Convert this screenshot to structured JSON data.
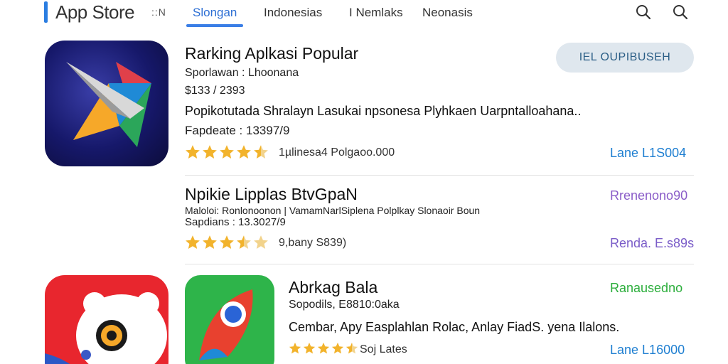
{
  "header": {
    "brand": "App Store",
    "brand_suffix": "::N",
    "tabs": [
      {
        "label": "Slongan",
        "active": true
      },
      {
        "label": "Indonesias",
        "active": false
      },
      {
        "label": "I Nemlaks",
        "active": false
      },
      {
        "label": "Neonasis",
        "active": false
      }
    ],
    "icons": [
      "search-icon",
      "search-icon"
    ],
    "accent": "#3a7ee6"
  },
  "apps": [
    {
      "title": "Rarking Aplkasi Popular",
      "subtitle": "Sporlawan : Lhoonana",
      "price": "$133 / 2393",
      "description": "Popikotutada Shralayn Lasukai npsonesa Plyhkaen Uarpntalloahana..",
      "update": "Fapdeate : 13397/9",
      "rating": 4.5,
      "rating_text": "1µlinesa4 Polgaoo.000",
      "action": "Lane L1S004",
      "action_color": "#1f7fd1",
      "button": "IEL OUPIBUSEH"
    },
    {
      "title": "Npikie Lipplas BtvGpaN",
      "subtitle": "Maloloi: Ronlonoonon | VamamNarlSiplena Polplkay Slonaoir Boun",
      "update": "Sapdians : 13.3027/9",
      "rating": 3.5,
      "rating_text": "9,bany S839)",
      "action_top": "Rrenenono90",
      "action_top_color": "#8a5cc8",
      "action": "Renda. E.s89s",
      "action_color": "#7a5cc8"
    },
    {
      "title": "Abrkag Bala",
      "subtitle": "Sopodils, E8810:0aka",
      "description": "Cembar, Apy Easplahlan Rolac, Anlay FiadS. yena Ilalons.",
      "rating": 4.5,
      "rating_text": "Soj Lates",
      "action_top": "Ranausedno",
      "action_top_color": "#2cae3c",
      "action": "Lane L16000",
      "action_color": "#1f7fd1"
    }
  ],
  "colors": {
    "star": "#f2b32c",
    "star_empty": "#f2d38c",
    "pill_bg": "#dfe7ee",
    "pill_text": "#2b5e86"
  }
}
